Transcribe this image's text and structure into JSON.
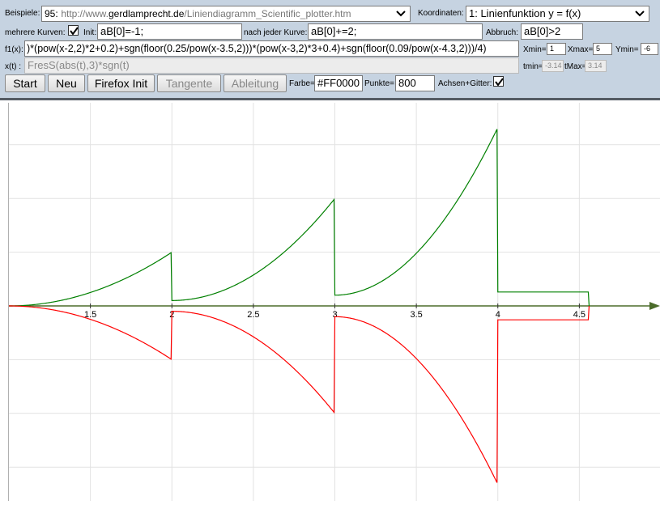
{
  "panel": {
    "beispiele_label": "Beispiele:",
    "beispiele_number": "95:",
    "beispiele_url_prefix": "http://www.",
    "beispiele_url_domain": "gerdlamprecht.de",
    "beispiele_url_path": "/Liniendiagramm_Scientific_plotter.htm",
    "koordinaten_label": "Koordinaten:",
    "koordinaten_value": "1: Linienfunktion y = f(x)",
    "mehrere_kurven_label": "mehrere Kurven:",
    "init_label": "Init:",
    "init_value": "aB[0]=-1;",
    "nach_jeder_kurve_label": "nach jeder Kurve:",
    "nach_jeder_kurve_value": "aB[0]+=2;",
    "abbruch_label": "Abbruch:",
    "abbruch_value": "aB[0]>2",
    "f1_label": "f1(x):",
    "f1_value": ")*(pow(x-2,2)*2+0.2)+sgn(floor(0.25/pow(x-3.5,2)))*(pow(x-3,2)*3+0.4)+sgn(floor(0.09/pow(x-4.3,2)))/4)",
    "xmin_label": "Xmin=",
    "xmin_value": "1",
    "xmax_label": "Xmax=",
    "xmax_value": "5",
    "ymin_label": "Ymin=",
    "ymin_value": "-6",
    "xt_label": "x(t) :",
    "xt_value": "FresS(abs(t),3)*sgn(t)",
    "tmin_label": "tmin=",
    "tmin_value": "-3.14",
    "tmax_label": "tMax=",
    "tmax_value": "3.14",
    "start_label": "Start",
    "neu_label": "Neu",
    "firefox_label": "Firefox Init",
    "tangente_label": "Tangente",
    "ableitung_label": "Ableitung",
    "farbe_label": "Farbe=",
    "farbe_value": "#FF0000",
    "punkte_label": "Punkte=",
    "punkte_value": "800",
    "achsen_label": "Achsen+Gitter:"
  },
  "chart_data": {
    "type": "line",
    "xlim": [
      1,
      5
    ],
    "x_tick_labels": [
      "1.5",
      "2",
      "2.5",
      "3",
      "3.5",
      "4",
      "4.5"
    ],
    "x_ticks": [
      1.5,
      2,
      2.5,
      3,
      3.5,
      4,
      4.5
    ],
    "grid": true,
    "series": [
      {
        "color": "#008000",
        "sign": 1
      },
      {
        "color": "#FF0000",
        "sign": -1
      }
    ]
  }
}
